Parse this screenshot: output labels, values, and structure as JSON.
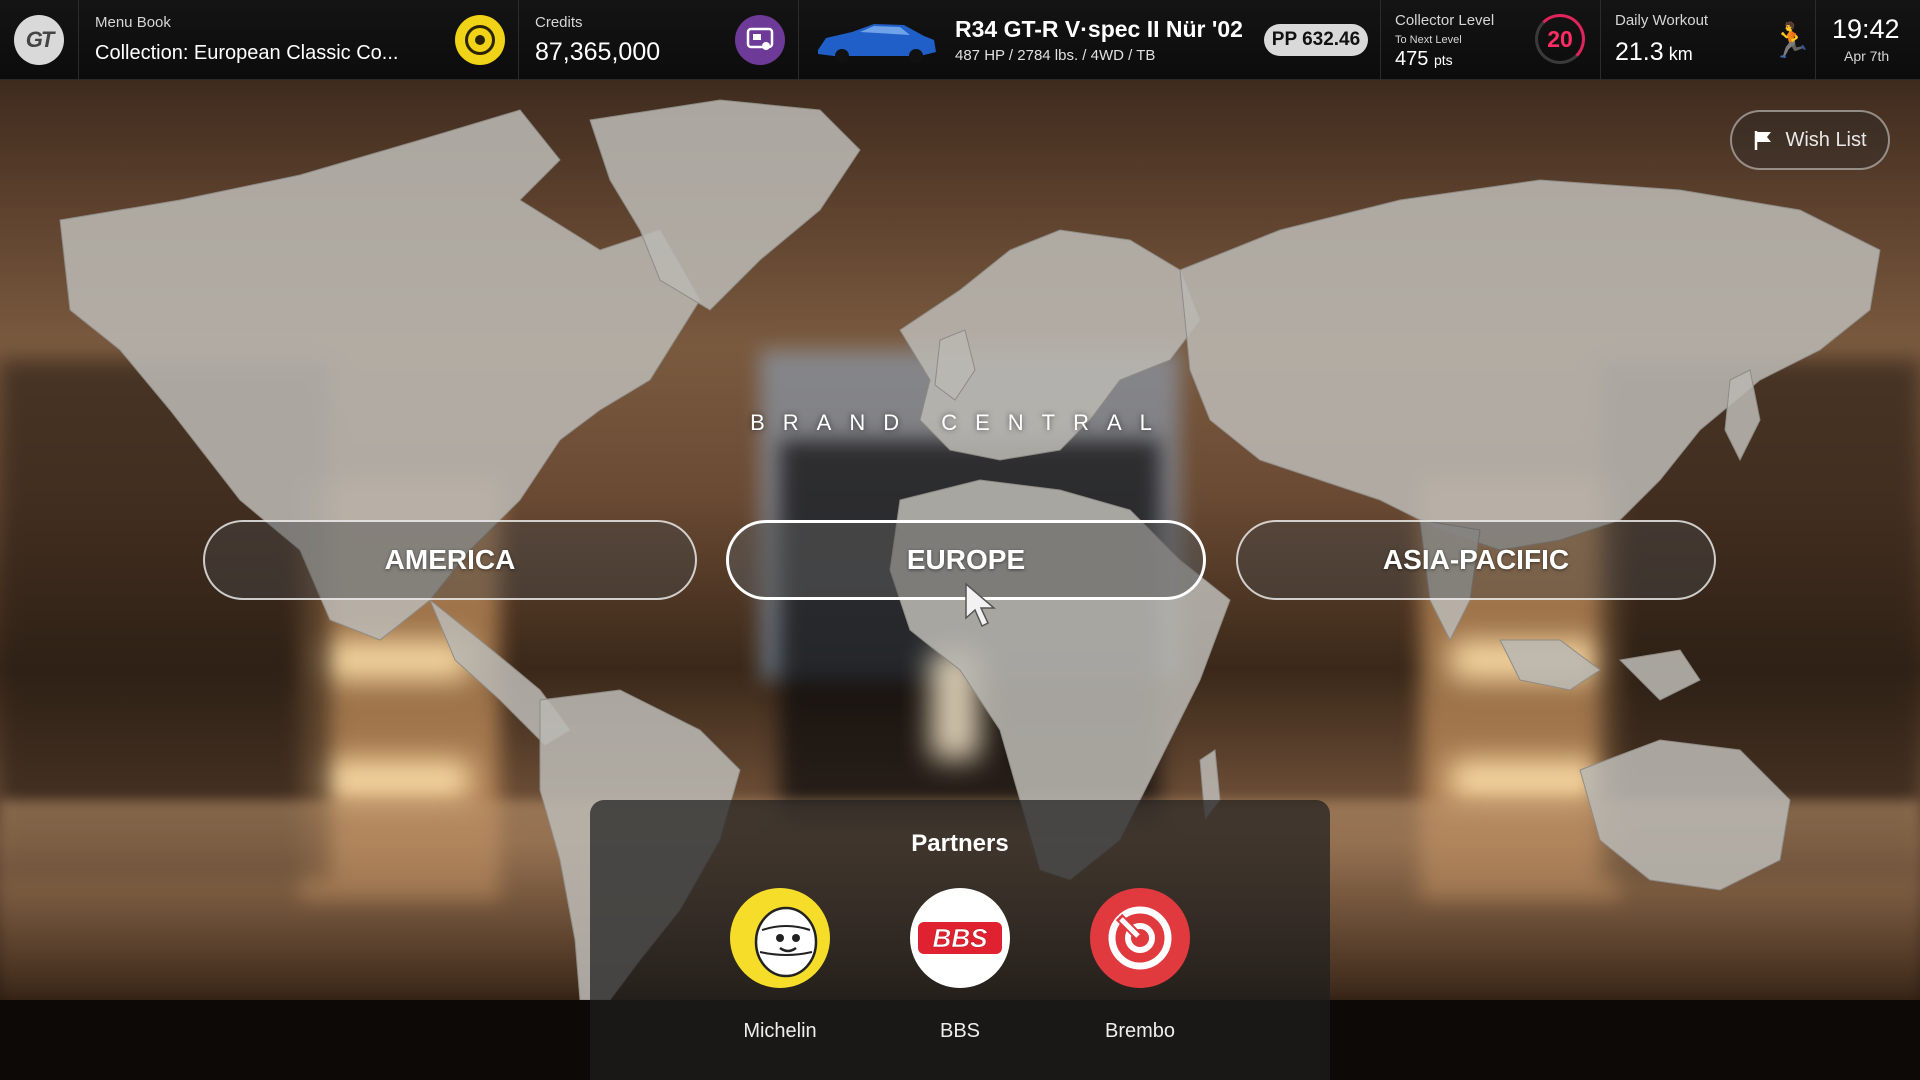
{
  "topbar": {
    "menu_book_label": "Menu Book",
    "menu_book_value": "Collection: European Classic Co...",
    "credits_label": "Credits",
    "credits_value": "87,365,000",
    "car_name": "R34 GT-R V·spec II Nür '02",
    "car_specs": "487 HP / 2784 lbs. / 4WD / TB",
    "pp_value": "PP 632.46",
    "collector_label": "Collector Level",
    "collector_sub": "To Next Level",
    "collector_points": "475",
    "collector_points_unit": "pts",
    "collector_level": "20",
    "workout_label": "Daily Workout",
    "workout_value": "21.3",
    "workout_unit": "km",
    "time": "19:42",
    "date": "Apr 7th"
  },
  "wishlist": {
    "label": "Wish List"
  },
  "title": "BRAND CENTRAL",
  "regions": [
    {
      "label": "AMERICA"
    },
    {
      "label": "EUROPE"
    },
    {
      "label": "ASIA-PACIFIC"
    }
  ],
  "partners": {
    "title": "Partners",
    "items": [
      {
        "name": "Michelin",
        "color": "#f6dd2a"
      },
      {
        "name": "BBS",
        "color": "#ffffff"
      },
      {
        "name": "Brembo",
        "color": "#e03a3e"
      }
    ]
  },
  "icons": [
    "gt-logo-icon",
    "credits-icon",
    "garage-icon",
    "flag-icon",
    "runner-icon",
    "cursor-icon"
  ]
}
